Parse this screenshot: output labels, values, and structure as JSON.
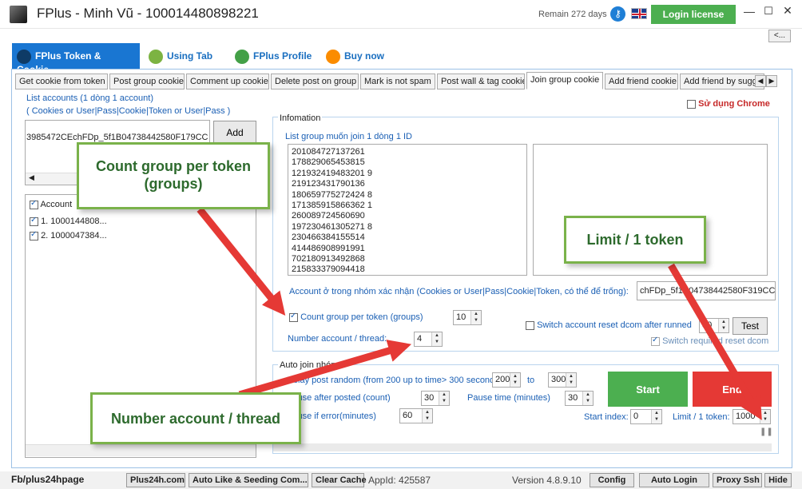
{
  "window": {
    "title": "FPlus - Minh Vũ - 100014480898221",
    "remain": "Remain 272 days",
    "login_license": "Login license",
    "minimize": "—",
    "maximize": "☐",
    "close": "✕",
    "collapse": "<..."
  },
  "main_nav": [
    {
      "label": "FPlus Token & Cookie",
      "icon": "cookie-icon"
    },
    {
      "label": "Using Tab",
      "icon": "link-icon"
    },
    {
      "label": "FPlus Profile",
      "icon": "group-icon"
    },
    {
      "label": "Buy now",
      "icon": "refresh-icon"
    }
  ],
  "subtabs": [
    "Get cookie from token",
    "Post group cookie",
    "Comment up cookie",
    "Delete post on group",
    "Mark is not spam",
    "Post wall & tag cookie",
    "Join group cookie",
    "Add friend cookie",
    "Add friend by sugge"
  ],
  "active_subtab": "Join group cookie",
  "left": {
    "list_title": "List accounts (1 dòng 1 account)",
    "list_sub": "( Cookies or User|Pass|Cookie|Token or User|Pass )",
    "cookie_value": "3985472CEchFDp_5f1B04738442580F179CC;",
    "add_label": "Add",
    "grid_header": "Account",
    "accounts": [
      "1. 1000144808...",
      "2. 1000047384..."
    ]
  },
  "info": {
    "chrome_label": "Sử dụng Chrome",
    "section_label": "Infomation",
    "group_list_label": "List group muốn join 1 dòng 1 ID",
    "group_ids": "201084727137261\n178829065453815\n121932419483201 9\n219123431790136\n180659775272424 8\n171385915866362 1\n260089724560690\n197230461305271 8\n230466384155514\n414486908991991\n702180913492868\n215833379094418",
    "confirm_label": "Account ở trong nhóm xác nhận (Cookies or User|Pass|Cookie|Token, có thể để trống):",
    "confirm_value": "chFDp_5f1B04738442580F319CC;",
    "count_label": "Count group per token (groups)",
    "count_value": "10",
    "switch_label": "Switch account  reset dcom after runned",
    "switch_value": "50",
    "test_label": "Test",
    "switch_required": "Switch required reset dcom",
    "numacc_label": "Number account  / thread:",
    "numacc_value": "4"
  },
  "auto": {
    "section_label": "Auto join nhóm",
    "delay_label": "Delay post random (from 200 up to time> 300 seconds)",
    "delay_min": "200",
    "to_label": "to",
    "delay_max": "300",
    "pause_label": "Pause after posted (count)",
    "pause_count": "30",
    "pausetime_label": "Pause time (minutes)",
    "pausetime_value": "30",
    "pauseerr_label": "Pause if error(minutes)",
    "pauseerr_value": "60",
    "start_label": "Start",
    "end_label": "End",
    "startidx_label": "Start index:",
    "startidx_value": "0",
    "limit_label": "Limit / 1 token:",
    "limit_value": "1000"
  },
  "callouts": {
    "count": "Count group per token\n(groups)",
    "limit": "Limit / 1 token",
    "numacc": "Number account / thread"
  },
  "status": {
    "page": "Fb/plus24hpage",
    "plus24": "Plus24h.com",
    "auto_like": "Auto Like & Seeding Com...",
    "clear_cache": "Clear Cache",
    "appid": "AppId: 425587",
    "version": "Version 4.8.9.10",
    "config": "Config",
    "auto_login": "Auto Login",
    "proxy": "Proxy Ssh",
    "hide": "Hide"
  },
  "colors": {
    "accent_blue": "#1976d2",
    "green": "#4caf50",
    "red": "#e53935",
    "callout_border": "#7ab24a",
    "arrow": "#e53935"
  }
}
